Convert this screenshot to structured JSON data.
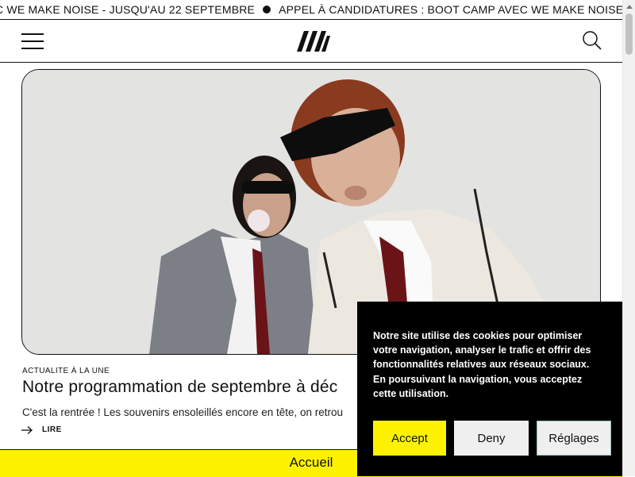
{
  "ticker": {
    "items": [
      "C WE MAKE NOISE - JUSQU'AU 22 SEPTEMBRE",
      "APPEL À CANDIDATURES : BOOT CAMP AVEC WE MAKE NOISE - J"
    ]
  },
  "header": {
    "logo": "WM logo",
    "menu_icon": "hamburger-icon",
    "search_icon": "search-icon"
  },
  "article": {
    "category": "ACTUALITE À LA UNE",
    "title": "Notre programmation de septembre à déc",
    "excerpt": "C'est la rentrée ! Les souvenirs ensoleillés encore en tête, on retrou",
    "read_label": "LIRE"
  },
  "bottom_bar": {
    "label": "Accueil"
  },
  "cookie_banner": {
    "text": "Notre site utilise des cookies pour optimiser votre navigation, analyser le trafic et offrir des fonctionnalités relatives aux réseaux sociaux. En poursuivant la navigation, vous acceptez cette utilisation.",
    "accept_label": "Accept",
    "deny_label": "Deny",
    "settings_label": "Réglages"
  },
  "colors": {
    "accent_yellow": "#fff200",
    "text": "#111111",
    "cookie_bg": "#000000"
  }
}
